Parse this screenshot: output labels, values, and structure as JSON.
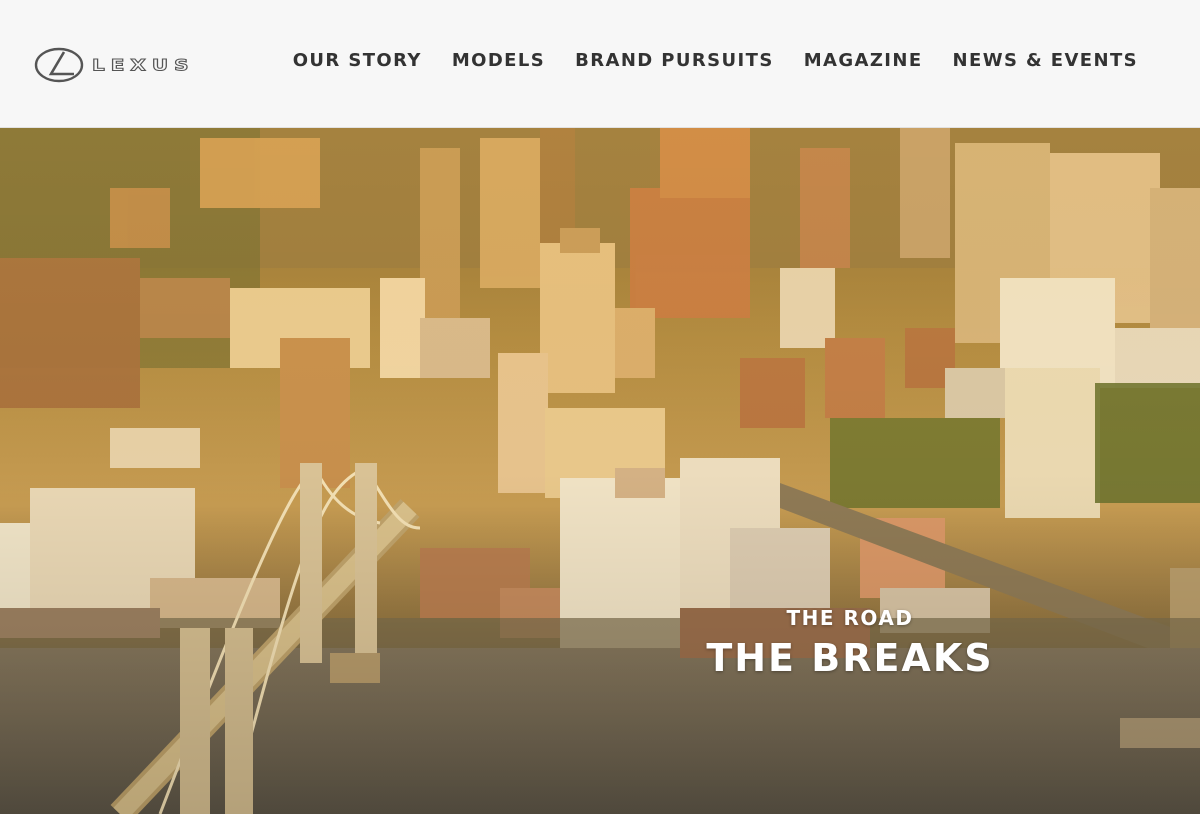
{
  "brand": {
    "logo_text": "LEXUS",
    "logo_icon": "lexus-l-emblem"
  },
  "nav": {
    "items": [
      {
        "label": "OUR STORY"
      },
      {
        "label": "MODELS"
      },
      {
        "label": "BRAND PURSUITS"
      },
      {
        "label": "MAGAZINE"
      },
      {
        "label": "NEWS & EVENTS"
      }
    ]
  },
  "hero": {
    "image": "aerial-city-bridge-photo",
    "kicker": "THE ROAD",
    "headline": "THE BREAKS"
  },
  "colors": {
    "header_bg": "#f7f7f7",
    "nav_text": "#333333",
    "caption_text": "#ffffff"
  }
}
